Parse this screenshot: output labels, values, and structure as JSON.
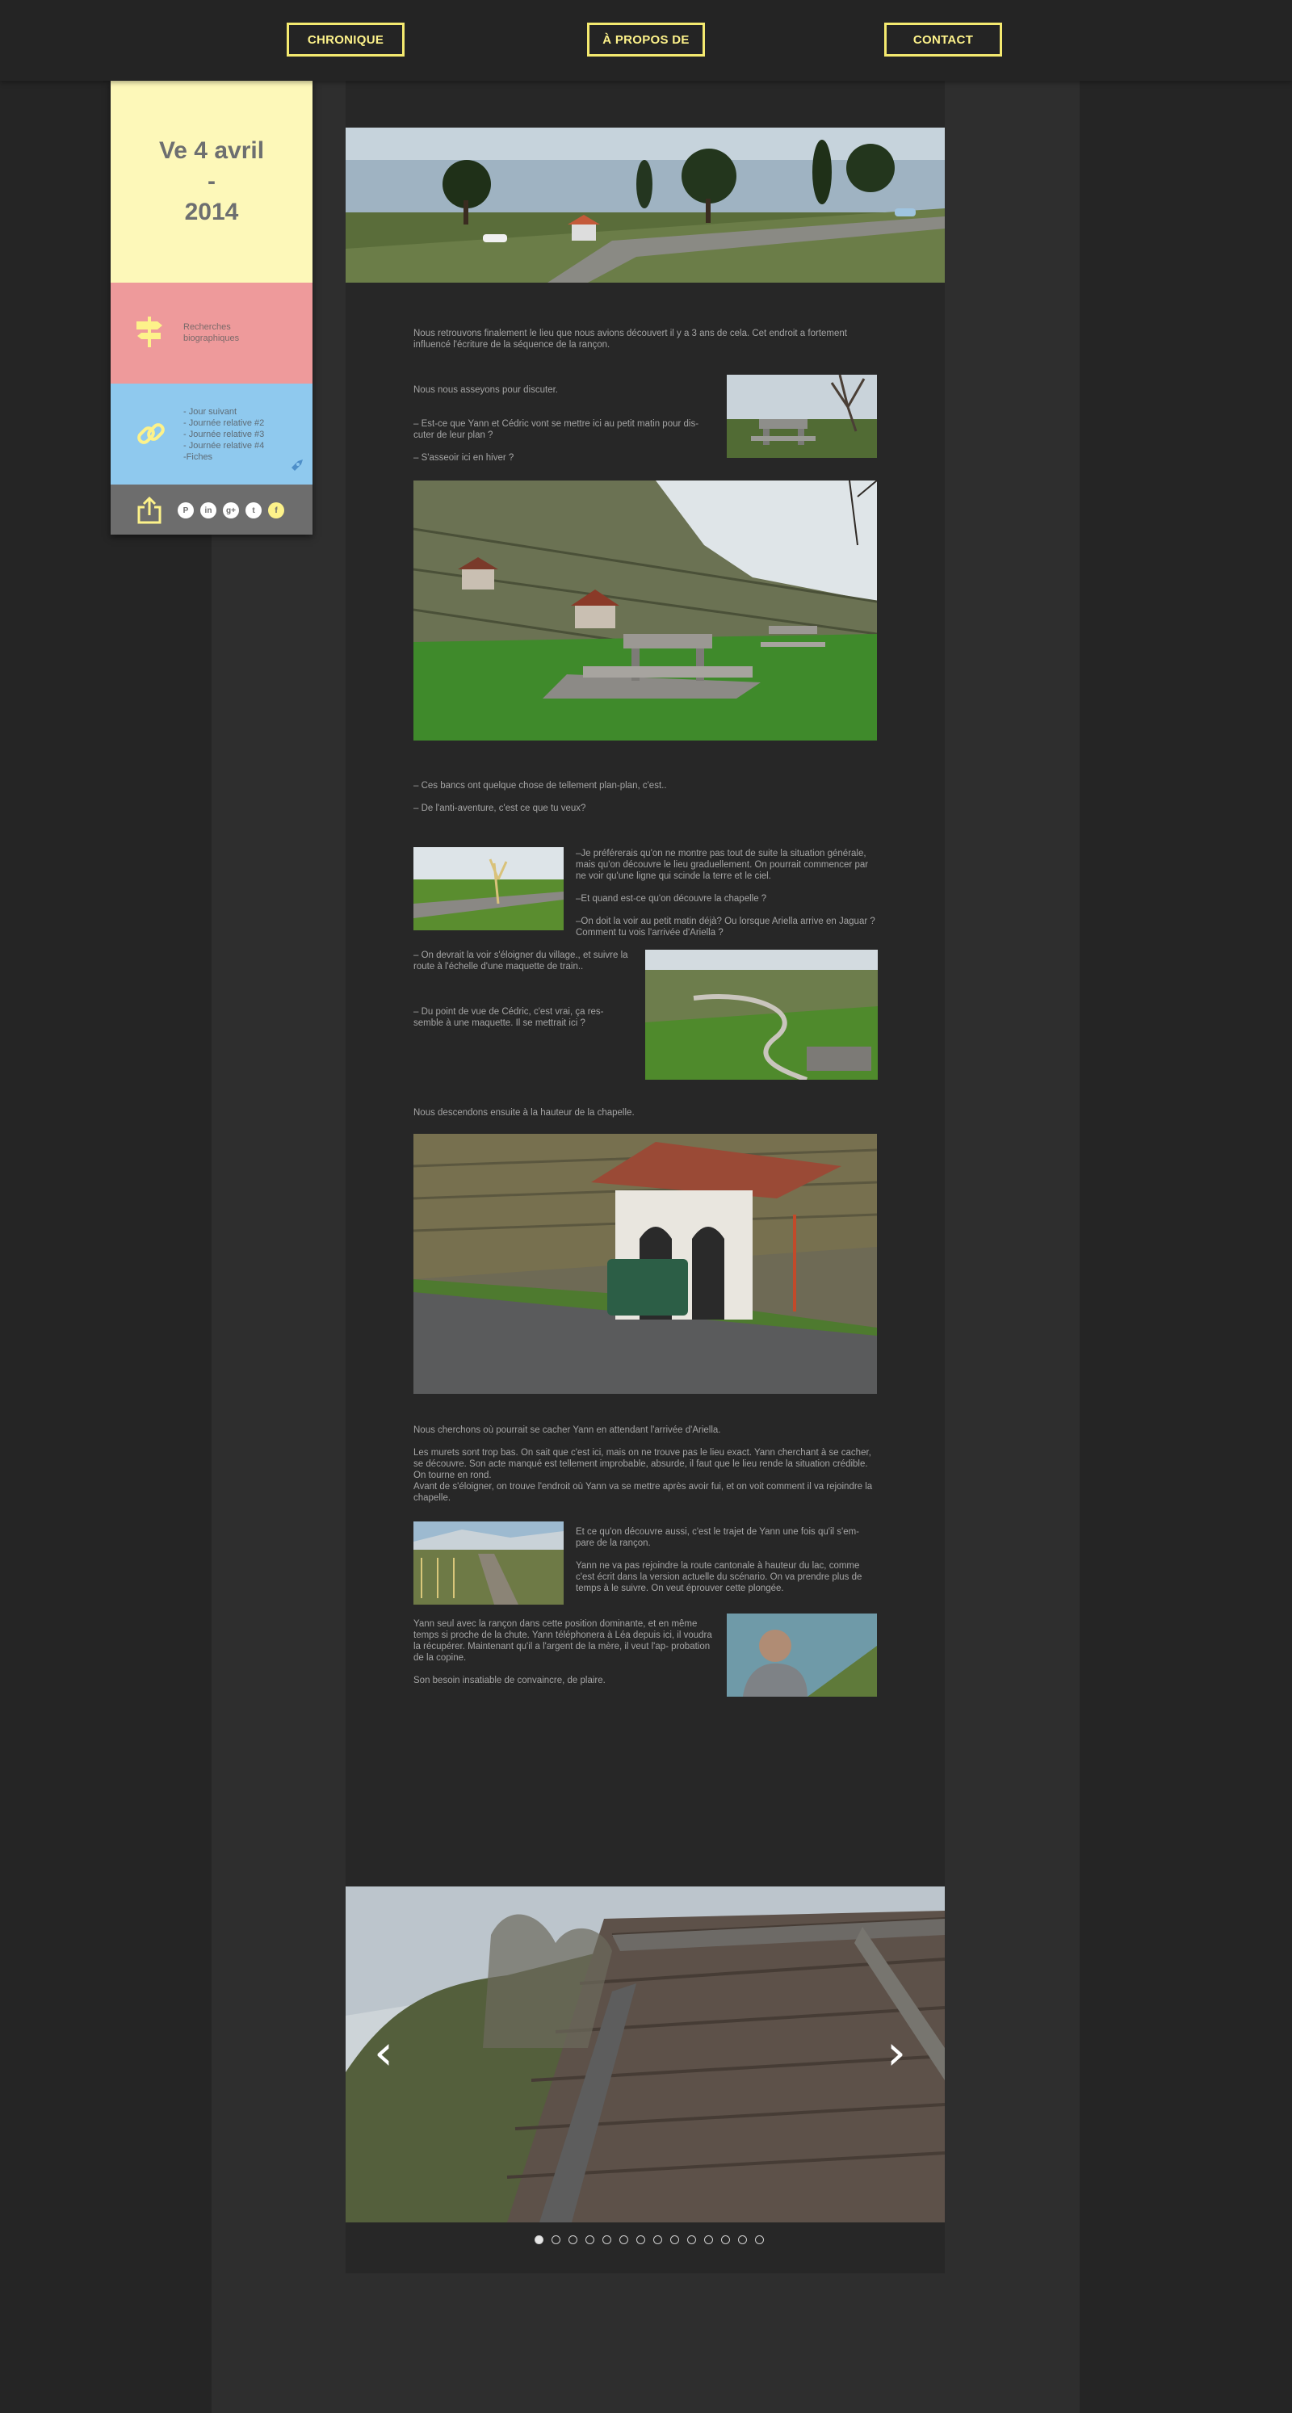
{
  "nav": [
    {
      "label": "CHRONIQUE"
    },
    {
      "label": "À PROPOS DE"
    },
    {
      "label": "CONTACT"
    }
  ],
  "sidebar": {
    "date_line1": "Ve 4 avril",
    "date_line2": "-",
    "date_line3": "2014",
    "research_links": [
      "Recherches",
      "biographiques"
    ],
    "related_links": [
      "- Jour suivant",
      "- Journée relative #2",
      "- Journée relative #3",
      "- Journée relative #4",
      "-Fiches"
    ],
    "icons": {
      "research": "signpost-icon",
      "links": "chain-link-icon",
      "share": "share-icon",
      "rocket": "rocket-icon"
    },
    "social": [
      {
        "name": "pinterest-icon",
        "glyph": "P"
      },
      {
        "name": "linkedin-icon",
        "glyph": "in"
      },
      {
        "name": "googleplus-icon",
        "glyph": "g+"
      },
      {
        "name": "twitter-icon",
        "glyph": "t"
      },
      {
        "name": "facebook-icon",
        "glyph": "f"
      }
    ]
  },
  "article": {
    "p1": "Nous retrouvons finalement le lieu que nous avions découvert il y a 3 ans de cela. Cet endroit a fortement influencé l'écriture de la séquence de la rançon.",
    "p2": "Nous nous asseyons pour discuter.",
    "p3": "– Est-ce que Yann et Cédric vont se mettre ici au petit matin pour dis- cuter de leur plan ?",
    "p4": "– S'asseoir ici en hiver ?",
    "p5": "– Ces bancs ont quelque chose de tellement plan-plan, c'est..",
    "p6": "– De l'anti-aventure, c'est ce que tu veux?",
    "p7": "–Je préférerais qu'on ne montre pas tout de suite la situation générale, mais qu'on découvre le lieu graduellement. On pourrait commencer par ne voir qu'une ligne qui scinde la terre et le ciel.",
    "p8": "–Et quand est-ce qu'on découvre la chapelle ?",
    "p9": "–On doit la voir au petit matin déjà? Ou lorsque Ariella arrive en Jaguar ? Comment tu vois l'arrivée d'Ariella ?",
    "p10": "– On devrait la voir s'éloigner du village., et suivre la route à l'échelle d'une maquette de train..",
    "p11": "– Du point de vue de Cédric, c'est vrai, ça res- semble à une maquette. Il se mettrait ici ?",
    "p12": "Nous descendons ensuite à la hauteur de la chapelle.",
    "p13": "Nous cherchons où pourrait se cacher Yann en attendant l'arrivée d'Ariella.",
    "p14": "Les murets sont trop bas. On sait que c'est ici, mais on ne trouve pas le lieu exact. Yann cherchant à se cacher, se découvre. Son acte manqué est tellement improbable, absurde, il faut que le lieu rende la situation crédible. On tourne en rond.",
    "p15": "Avant de s'éloigner, on trouve l'endroit où Yann va se mettre après avoir fui, et on voit comment il va rejoindre la chapelle.",
    "p16": "Et ce qu'on découvre aussi, c'est le trajet de Yann une fois qu'il s'em- pare de la rançon.",
    "p17": "Yann ne va pas rejoindre la route cantonale à hauteur du lac, comme c'est écrit dans la version actuelle du scénario. On va prendre plus de temps à le suivre. On veut éprouver cette plongée.",
    "p18": "Yann seul avec la rançon dans cette position dominante, et en même temps si proche de la chute. Yann téléphonera à Léa depuis ici, il voudra la récupérer. Maintenant qu'il a l'argent de la mère, il veut l'ap- probation de la copine.",
    "p19": "Son besoin insatiable de convaincre, de plaire."
  },
  "gallery": {
    "prev_glyph": "‹",
    "next_glyph": "›",
    "slide_count": 14,
    "active_index": 0
  }
}
